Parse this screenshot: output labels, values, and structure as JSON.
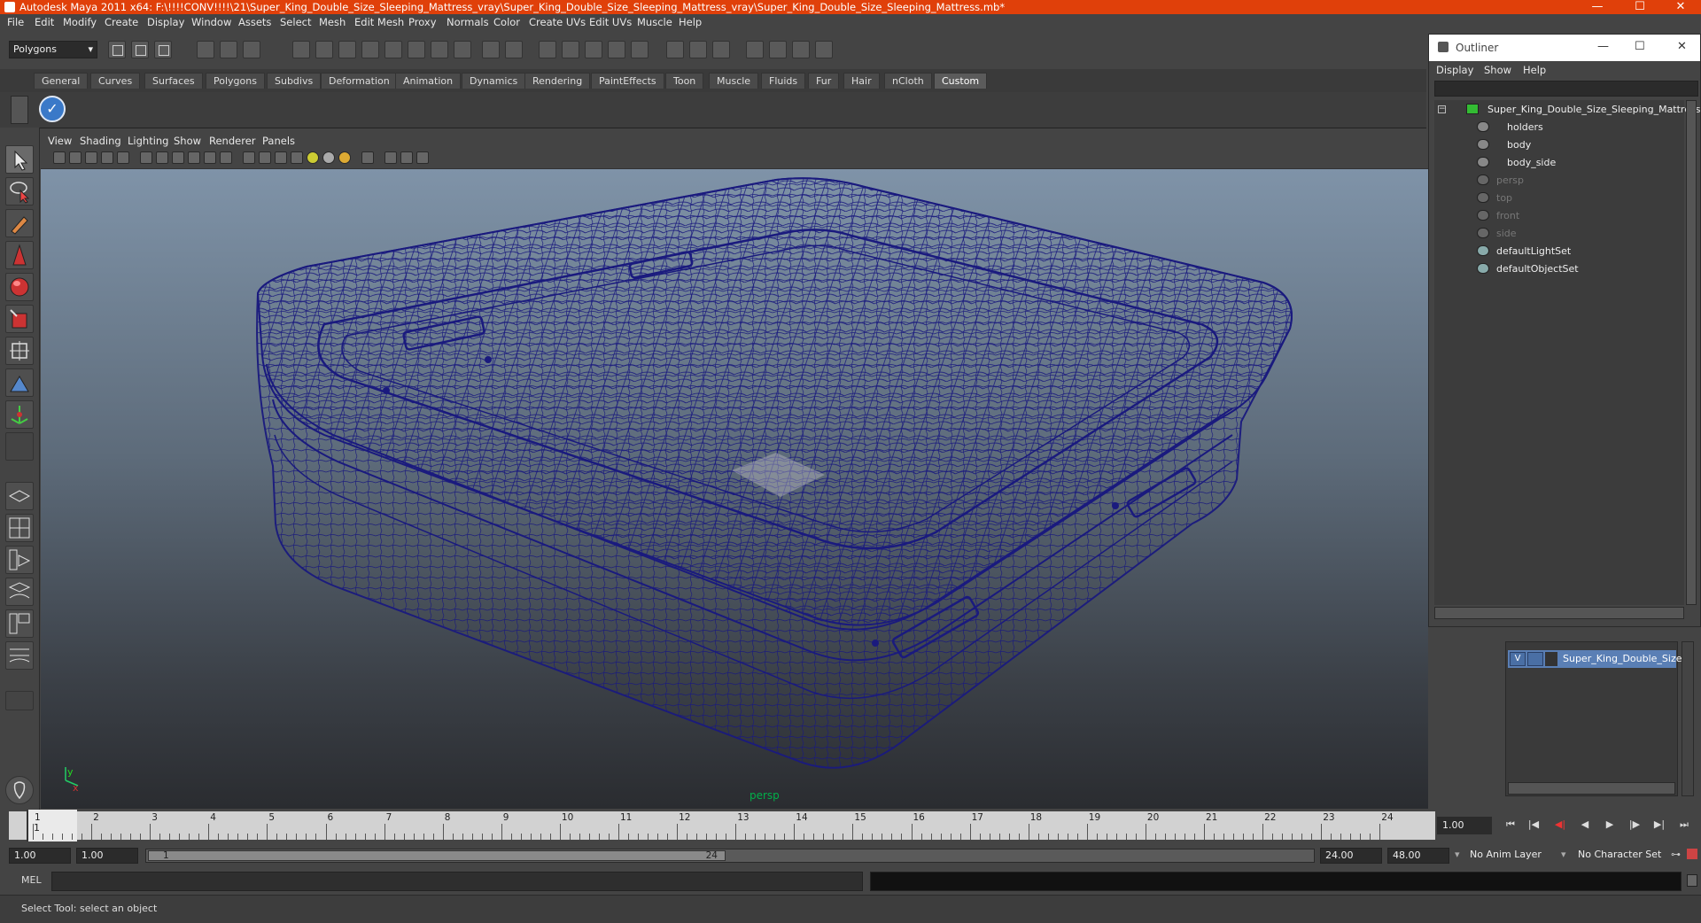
{
  "window": {
    "title": "Autodesk Maya 2011 x64: F:\\!!!!CONV!!!!\\21\\Super_King_Double_Size_Sleeping_Mattress_vray\\Super_King_Double_Size_Sleeping_Mattress_vray\\Super_King_Double_Size_Sleeping_Mattress.mb*",
    "minimize": "—",
    "maximize": "☐",
    "close": "✕"
  },
  "menubar": [
    "File",
    "Edit",
    "Modify",
    "Create",
    "Display",
    "Window",
    "Assets",
    "Select",
    "Mesh",
    "Edit Mesh",
    "Proxy",
    "Normals",
    "Color",
    "Create UVs",
    "Edit UVs",
    "Muscle",
    "Help"
  ],
  "statusline": {
    "mode": "Polygons"
  },
  "shelf_tabs": [
    "General",
    "Curves",
    "Surfaces",
    "Polygons",
    "Subdivs",
    "Deformation",
    "Animation",
    "Dynamics",
    "Rendering",
    "PaintEffects",
    "Toon",
    "Muscle",
    "Fluids",
    "Fur",
    "Hair",
    "nCloth",
    "Custom"
  ],
  "shelf_active": "Custom",
  "viewport": {
    "menu": [
      "View",
      "Shading",
      "Lighting",
      "Show",
      "Renderer",
      "Panels"
    ],
    "camera_label": "persp",
    "axis_y": "y",
    "axis_x": "x"
  },
  "outliner": {
    "title": "Outliner",
    "menu": [
      "Display",
      "Show",
      "Help"
    ],
    "items": [
      {
        "label": "Super_King_Double_Size_Sleeping_Mattress",
        "dim": false,
        "indent": 0,
        "icon": "transform-icon"
      },
      {
        "label": "holders",
        "dim": false,
        "indent": 1,
        "icon": "mesh-icon"
      },
      {
        "label": "body",
        "dim": false,
        "indent": 1,
        "icon": "mesh-icon"
      },
      {
        "label": "body_side",
        "dim": false,
        "indent": 1,
        "icon": "mesh-icon"
      },
      {
        "label": "persp",
        "dim": true,
        "indent": 0,
        "icon": "camera-icon"
      },
      {
        "label": "top",
        "dim": true,
        "indent": 0,
        "icon": "camera-icon"
      },
      {
        "label": "front",
        "dim": true,
        "indent": 0,
        "icon": "camera-icon"
      },
      {
        "label": "side",
        "dim": true,
        "indent": 0,
        "icon": "camera-icon"
      },
      {
        "label": "defaultLightSet",
        "dim": false,
        "indent": 0,
        "icon": "set-icon"
      },
      {
        "label": "defaultObjectSet",
        "dim": false,
        "indent": 0,
        "icon": "set-icon"
      }
    ]
  },
  "layer_editor": {
    "layer_name": "Super_King_Double_Size",
    "visibility": "V"
  },
  "timeslider": {
    "ticks": [
      "1",
      "2",
      "3",
      "4",
      "5",
      "6",
      "7",
      "8",
      "9",
      "10",
      "11",
      "12",
      "13",
      "14",
      "15",
      "16",
      "17",
      "18",
      "19",
      "20",
      "21",
      "22",
      "23",
      "24"
    ],
    "current_frame": "1",
    "current_frame_field": "1.00"
  },
  "range": {
    "start_time": "1.00",
    "start_range": "1.00",
    "range_start_label": "1",
    "range_end_label": "24",
    "end_range": "24.00",
    "end_time": "48.00",
    "anim_layer": "No Anim Layer",
    "character_set": "No Character Set"
  },
  "cmdline": {
    "label": "MEL"
  },
  "helpline": {
    "text": "Select Tool: select an object"
  },
  "colors": {
    "titlebar": "#e0400a",
    "wireframe": "#1a1a7e",
    "persp_label": "#00b14a"
  }
}
